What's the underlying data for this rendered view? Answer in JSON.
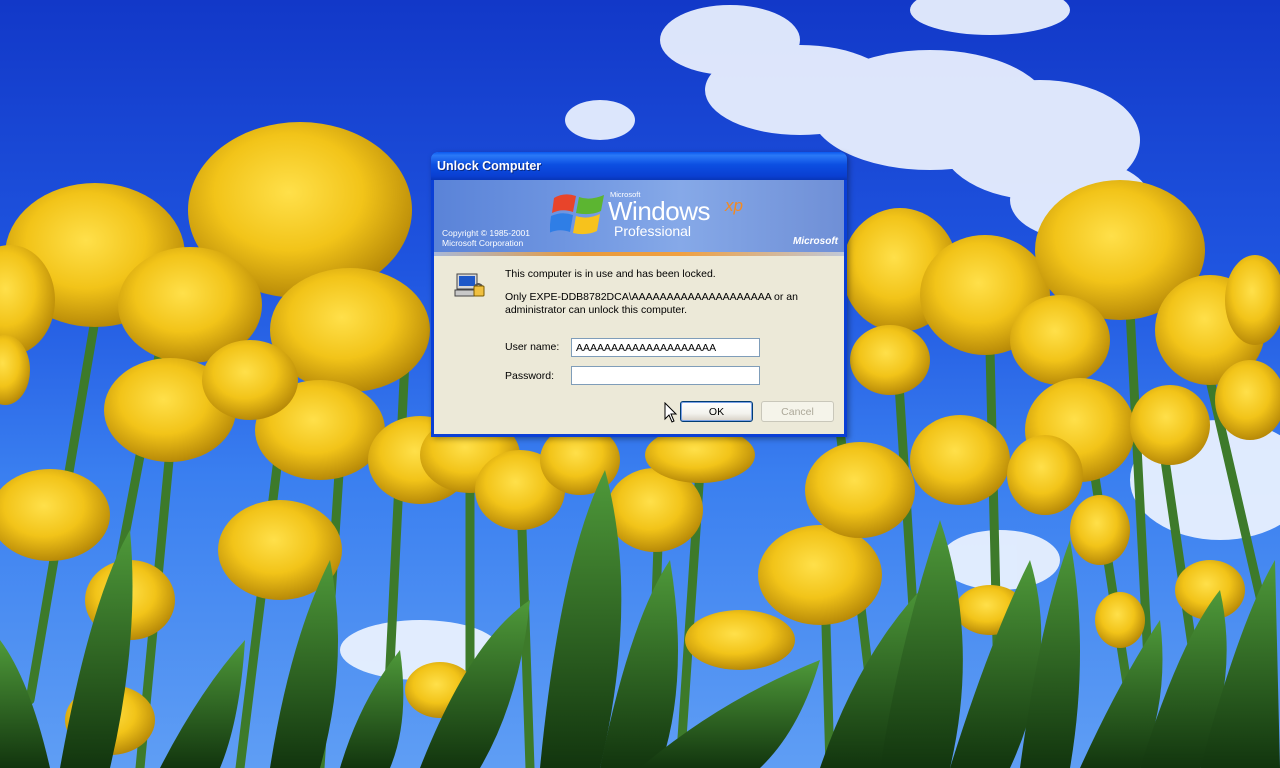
{
  "dialog": {
    "title": "Unlock Computer",
    "banner": {
      "copyright_line1": "Copyright © 1985-2001",
      "copyright_line2": "Microsoft Corporation",
      "brand_microsoft": "Microsoft",
      "brand_windows": "Windows",
      "brand_xp": "xp",
      "brand_edition": "Professional",
      "brand_corp": "Microsoft"
    },
    "message_locked": "This computer is in use and has been locked.",
    "message_unlock_line1": "Only EXPE-DDB8782DCA\\AAAAAAAAAAAAAAAAAAAA or an",
    "message_unlock_line2": "administrator can unlock this computer.",
    "username_label": "User name:",
    "username_value": "AAAAAAAAAAAAAAAAAAAA",
    "password_label": "Password:",
    "password_value": "",
    "ok_label": "OK",
    "cancel_label": "Cancel",
    "icon": "locked-computer-icon"
  },
  "colors": {
    "title_bar": "#0a3fd6",
    "dialog_bg": "#ece9d8",
    "sky": "#1f55e0",
    "tulip": "#f2c419",
    "stem": "#3d7a2a"
  }
}
